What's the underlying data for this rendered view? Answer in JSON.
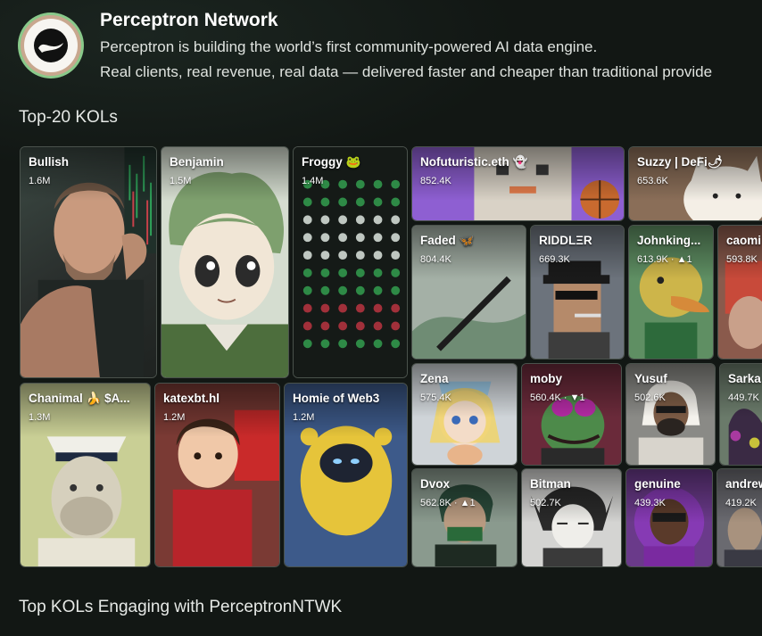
{
  "header": {
    "title": "Perceptron Network",
    "description_line1": "Perceptron is building the world’s first community-powered AI data engine.",
    "description_line2": "Real clients, real revenue, real data — delivered faster and cheaper than traditional provide"
  },
  "sections": {
    "top_kols": "Top-20 KOLs",
    "engaging": "Top KOLs Engaging with PerceptronNTWK"
  },
  "kols": [
    {
      "name": "Bullish",
      "followers": "1.6M"
    },
    {
      "name": "Benjamin",
      "followers": "1.5M"
    },
    {
      "name": "Froggy 🐸",
      "followers": "1.4M"
    },
    {
      "name": "Nofuturistic.eth 👻",
      "followers": "852.4K"
    },
    {
      "name": "Suzzy | DeFi🌶",
      "followers": "653.6K"
    },
    {
      "name": "Faded 🦋",
      "followers": "804.4K"
    },
    {
      "name": "RIDDLΞR",
      "followers": "669.3K"
    },
    {
      "name": "Johnking...",
      "followers": "613.9K · ▲1"
    },
    {
      "name": "caomi",
      "followers": "593.8K"
    },
    {
      "name": "Chanimal 🍌 $A...",
      "followers": "1.3M"
    },
    {
      "name": "katexbt.hl",
      "followers": "1.2M"
    },
    {
      "name": "Homie of Web3",
      "followers": "1.2M"
    },
    {
      "name": "Zena",
      "followers": "575.4K"
    },
    {
      "name": "moby",
      "followers": "560.4K · ▼1"
    },
    {
      "name": "Yusuf",
      "followers": "502.6K"
    },
    {
      "name": "Sarka",
      "followers": "449.7K"
    },
    {
      "name": "Dvox",
      "followers": "562.8K · ▲1"
    },
    {
      "name": "Bitman",
      "followers": "502.7K"
    },
    {
      "name": "genuine",
      "followers": "439.3K"
    },
    {
      "name": "andrew",
      "followers": "419.2K"
    }
  ],
  "colors": {
    "background": "#121714",
    "logo_ring": "#89c98a"
  },
  "icons": {
    "logo": "perceptron-logo-icon"
  }
}
